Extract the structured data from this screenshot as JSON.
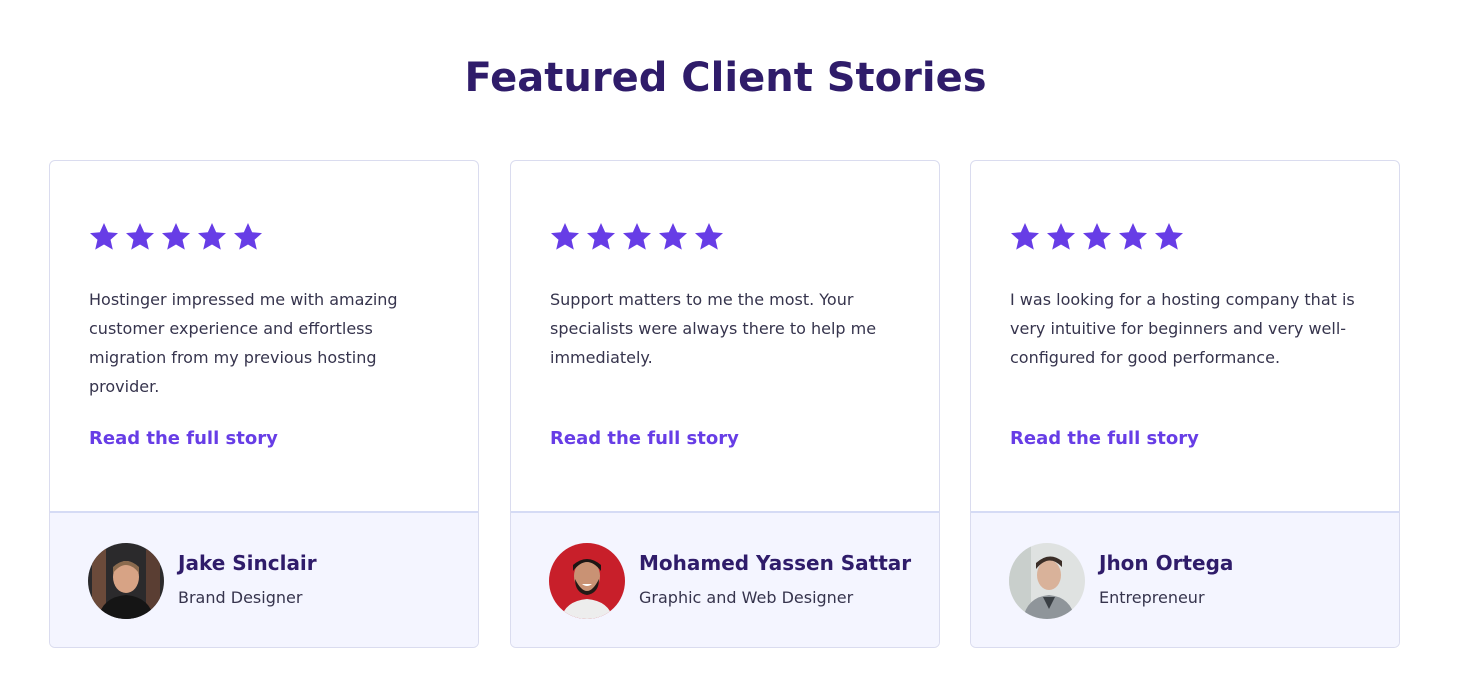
{
  "section": {
    "title": "Featured Client Stories"
  },
  "colors": {
    "heading": "#2f1c6a",
    "accent": "#673de6",
    "body_text": "#36344d",
    "card_border": "#dadcef",
    "card_footer_bg": "#f4f5ff"
  },
  "cards": [
    {
      "rating": 5,
      "star_icon": "star-icon",
      "quote": "Hostinger impressed me with amazing customer experience and effortless migration from my previous hosting provider.",
      "link_label": "Read the full story",
      "name": "Jake Sinclair",
      "role": "Brand Designer"
    },
    {
      "rating": 5,
      "star_icon": "star-icon",
      "quote": "Support matters to me the most. Your specialists were always there to help me immediately.",
      "link_label": "Read the full story",
      "name": "Mohamed Yassen Sattar",
      "role": "Graphic and Web Designer"
    },
    {
      "rating": 5,
      "star_icon": "star-icon",
      "quote": "I was looking for a hosting company that is very intuitive for beginners and very well-configured for good performance.",
      "link_label": "Read the full story",
      "name": "Jhon Ortega",
      "role": "Entrepreneur"
    }
  ]
}
